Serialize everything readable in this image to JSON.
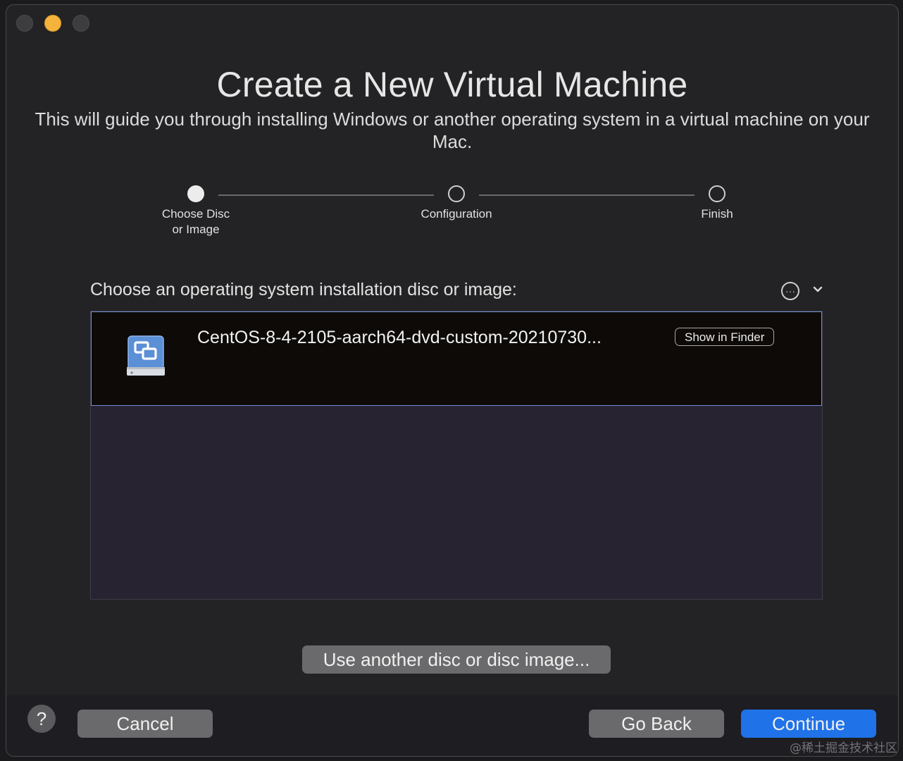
{
  "window": {
    "title": "Create a New Virtual Machine",
    "subtitle": "This will guide you through installing Windows or another operating system in a virtual machine on your Mac."
  },
  "steps": [
    {
      "label": "Choose Disc\nor Image",
      "active": true
    },
    {
      "label": "Configuration",
      "active": false
    },
    {
      "label": "Finish",
      "active": false
    }
  ],
  "chooser": {
    "label": "Choose an operating system installation disc or image:",
    "more_icon": "ellipsis-circle-icon",
    "chevron_icon": "chevron-down-icon"
  },
  "disc_list": {
    "items": [
      {
        "name": "CentOS-8-4-2105-aarch64-dvd-custom-20210730...",
        "icon": "disk-image-icon",
        "action_label": "Show in Finder"
      }
    ]
  },
  "buttons": {
    "another_disc": "Use another disc or disc image...",
    "help": "?",
    "cancel": "Cancel",
    "go_back": "Go Back",
    "continue": "Continue"
  },
  "watermark": "@稀土掘金技术社区",
  "colors": {
    "accent": "#1f72e8",
    "selection_border": "#6f8fd8",
    "minimize_light": "#f6b33c"
  }
}
